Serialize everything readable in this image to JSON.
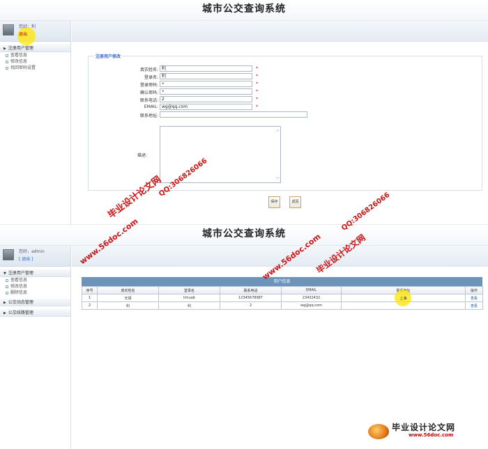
{
  "app_title": "城市公交查询系统",
  "panel1": {
    "sidebar": {
      "greeting": "您好：利",
      "logout": "退出",
      "groups": [
        {
          "label": "注册用户管理",
          "items": [
            "查看信息",
            "修改信息",
            "找回密码设置"
          ]
        }
      ]
    },
    "form": {
      "legend": "注册用户修改",
      "fields": [
        {
          "label": "真实姓名:",
          "value": "利",
          "required": "*"
        },
        {
          "label": "登录名:",
          "value": "利",
          "required": "*"
        },
        {
          "label": "登录密码:",
          "value": "•",
          "required": "*"
        },
        {
          "label": "确认密码:",
          "value": "•",
          "required": "*"
        },
        {
          "label": "联系电话:",
          "value": "2",
          "required": "*"
        },
        {
          "label": "EMAIL:",
          "value": "wg@qq.com",
          "required": "*"
        },
        {
          "label": "联系地址:",
          "value": "",
          "required": ""
        }
      ],
      "desc_label": "描述:",
      "scroll_up": "︿",
      "scroll_down": "﹀",
      "save_label": "保存",
      "back_label": "返回"
    }
  },
  "panel2": {
    "sidebar": {
      "greeting": "您好，admin",
      "logout": "[ 退出 ]",
      "groups": [
        {
          "label": "注册用户管理",
          "items": [
            "查看信息",
            "修改信息",
            "删除信息"
          ]
        },
        {
          "label": "公交动态管理",
          "items": []
        },
        {
          "label": "公交线路管理",
          "items": []
        }
      ]
    },
    "table": {
      "caption": "用户信息",
      "columns": [
        "序号",
        "真实姓名",
        "登录名",
        "联系电话",
        "EMAIL",
        "联系地址",
        "操作"
      ],
      "rows": [
        [
          "1",
          "无谓",
          "limuab",
          "12345678987",
          "23432432",
          "上海",
          "查看"
        ],
        [
          "2",
          "利",
          "利",
          "2",
          "wg@qq.com",
          "",
          "查看"
        ]
      ]
    }
  },
  "watermarks": {
    "site": "www.56doc.com",
    "brand": "毕业设计论文网",
    "qq": "QQ:306826066"
  },
  "footer": {
    "brand": "毕业设计论文网",
    "url": "www.56doc.com"
  },
  "colors": {
    "accent_blue": "#6d93b8",
    "watermark_red": "#cc1414",
    "cursor_highlight": "#ffe600"
  }
}
